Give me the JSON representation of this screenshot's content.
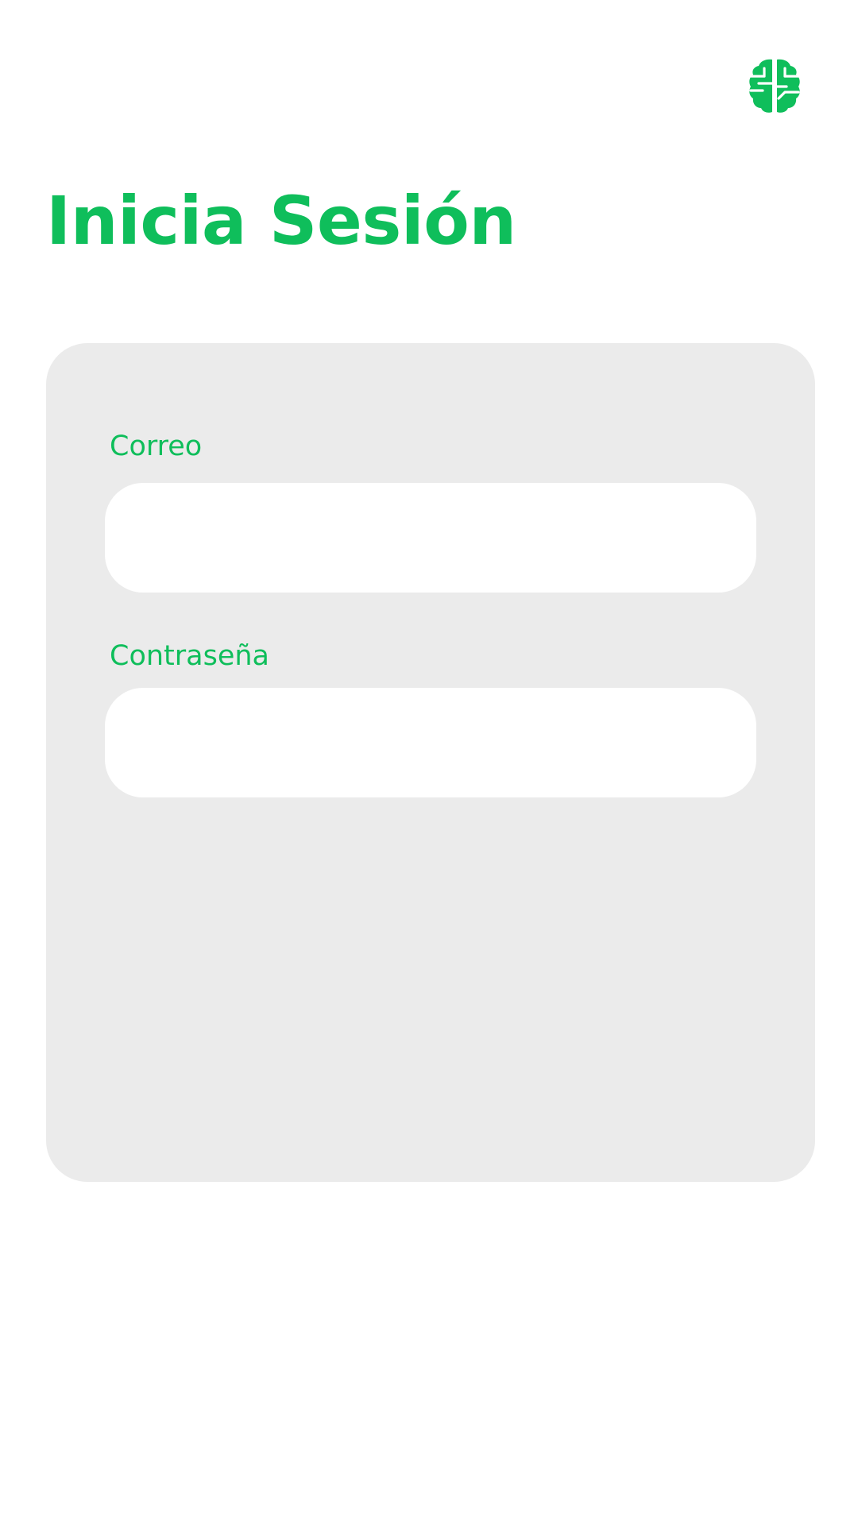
{
  "app": {
    "logo_icon": "brain-icon",
    "accent_color": "#0fbe5b"
  },
  "page": {
    "title": "Inicia Sesión"
  },
  "login_form": {
    "email": {
      "label": "Correo",
      "value": "",
      "placeholder": ""
    },
    "password": {
      "label": "Contraseña",
      "value": "",
      "placeholder": ""
    }
  }
}
